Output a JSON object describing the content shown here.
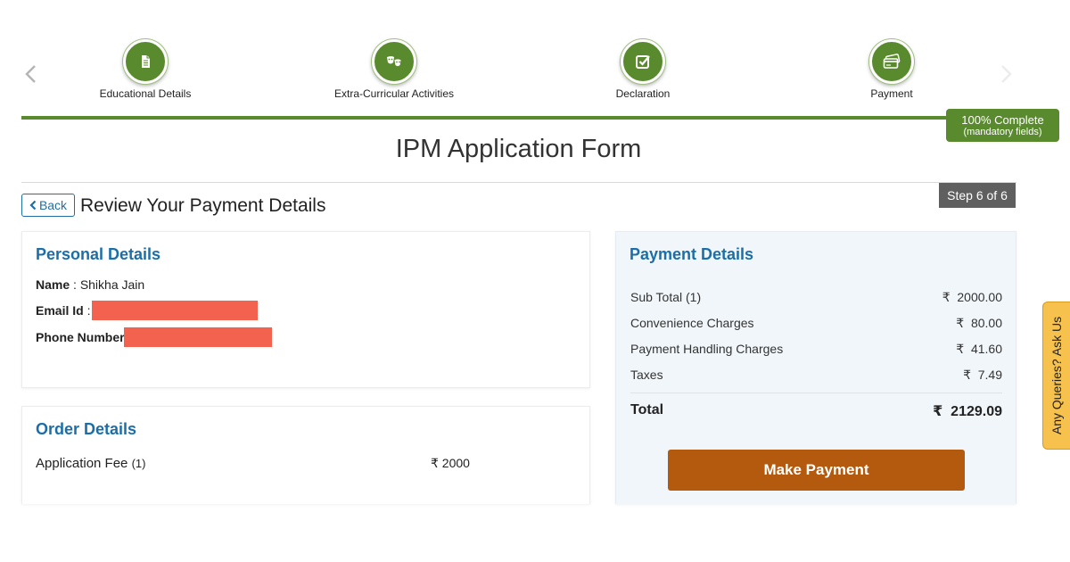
{
  "stepper": {
    "steps": [
      {
        "label": "Educational Details",
        "icon": "document-icon"
      },
      {
        "label": "Extra-Curricular Activities",
        "icon": "masks-icon"
      },
      {
        "label": "Declaration",
        "icon": "checkbox-icon"
      },
      {
        "label": "Payment",
        "icon": "credit-card-icon"
      }
    ],
    "progress_complete": "100% Complete",
    "progress_note": "(mandatory fields)",
    "accent_color": "#5a8a2e"
  },
  "page": {
    "title": "IPM Application Form",
    "step_indicator": "Step 6 of 6",
    "back_label": "Back",
    "section_title": "Review Your Payment Details"
  },
  "personal_details": {
    "heading": "Personal Details",
    "name_label": "Name",
    "name_value": "Shikha Jain",
    "email_label": "Email Id",
    "phone_label": "Phone Number",
    "redaction_color": "#f3624f"
  },
  "order_details": {
    "heading": "Order Details",
    "item_label": "Application Fee",
    "item_qty": "(1)",
    "item_amount": "₹ 2000"
  },
  "payment_details": {
    "heading": "Payment Details",
    "rows": [
      {
        "label": "Sub Total (1)",
        "amount": "₹  2000.00"
      },
      {
        "label": "Convenience Charges",
        "amount": "₹  80.00"
      },
      {
        "label": "Payment Handling Charges",
        "amount": "₹  41.60"
      },
      {
        "label": "Taxes",
        "amount": "₹  7.49"
      }
    ],
    "total_label": "Total",
    "total_amount": "₹  2129.09",
    "button_label": "Make Payment",
    "button_color": "#b35a0f"
  },
  "side_tab": {
    "label": "Any Queries? Ask Us"
  }
}
